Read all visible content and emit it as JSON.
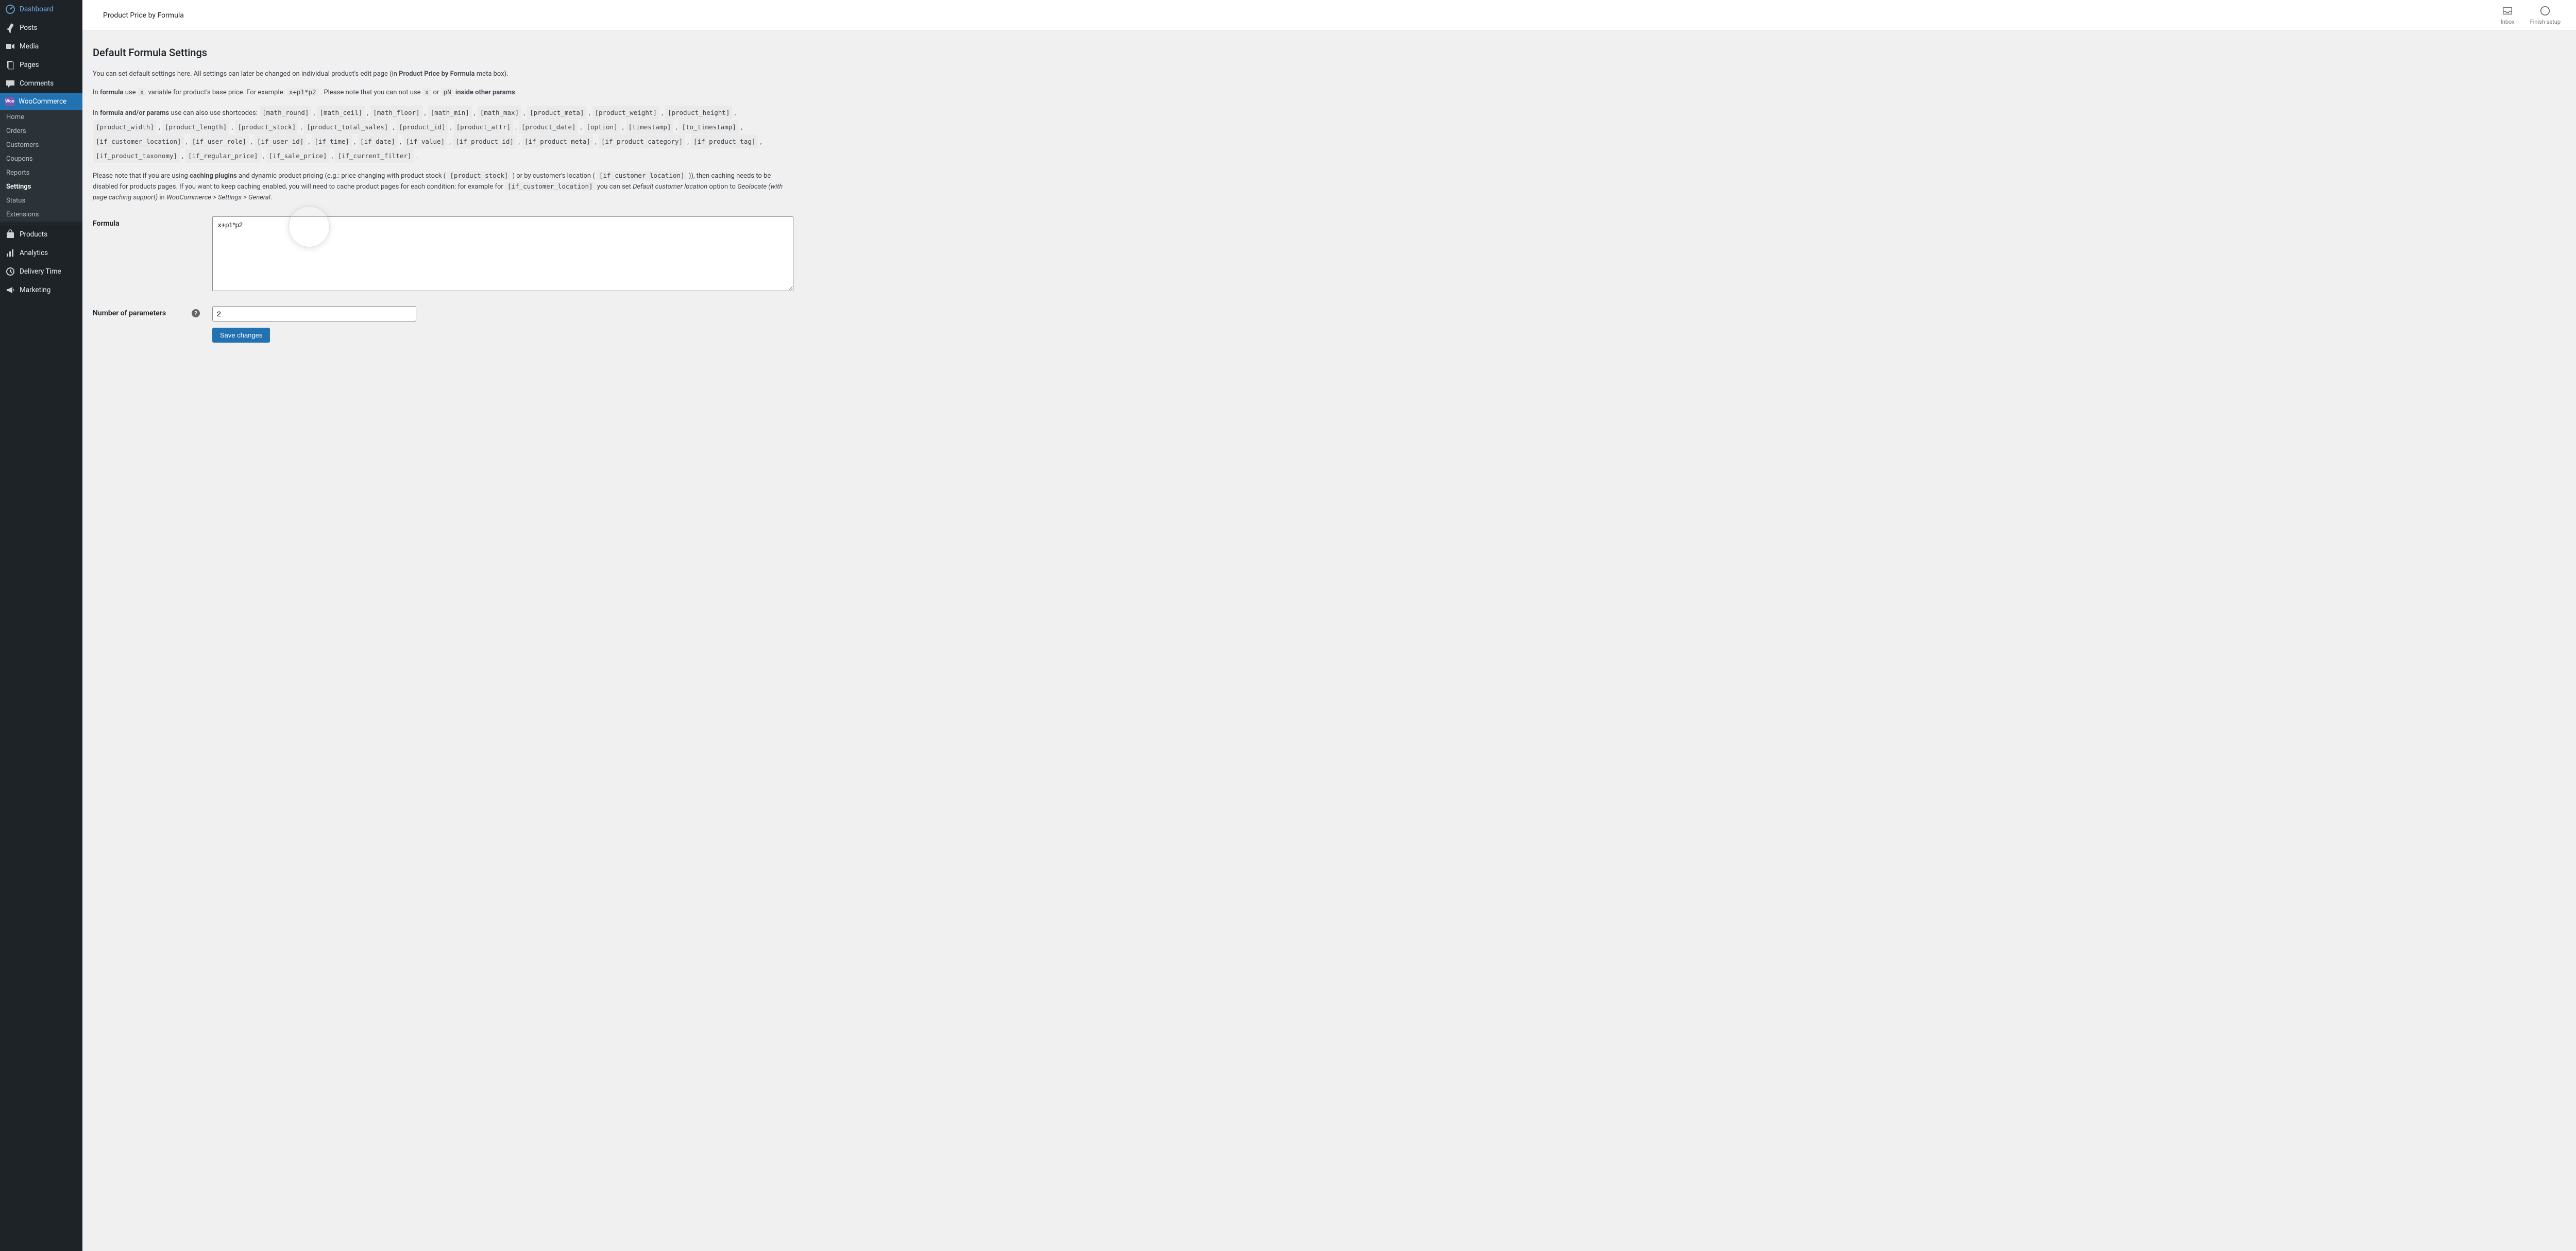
{
  "sidebar": {
    "items": [
      {
        "label": "Dashboard"
      },
      {
        "label": "Posts"
      },
      {
        "label": "Media"
      },
      {
        "label": "Pages"
      },
      {
        "label": "Comments"
      },
      {
        "label": "WooCommerce"
      },
      {
        "label": "Products"
      },
      {
        "label": "Analytics"
      },
      {
        "label": "Delivery Time"
      },
      {
        "label": "Marketing"
      }
    ],
    "sub": [
      "Home",
      "Orders",
      "Customers",
      "Coupons",
      "Reports",
      "Settings",
      "Status",
      "Extensions"
    ]
  },
  "topbar": {
    "title": "Product Price by Formula",
    "inbox": "Inbox",
    "finish": "Finish setup"
  },
  "page": {
    "heading": "Default Formula Settings",
    "p1_a": "You can set default settings here. All settings can later be changed on individual product's edit page (in ",
    "p1_b": "Product Price by Formula",
    "p1_c": " meta box).",
    "p2_a": "In ",
    "p2_b": "formula",
    "p2_c": " use ",
    "p2_code1": "x",
    "p2_d": " variable for product's base price. For example: ",
    "p2_code2": "x+p1*p2",
    "p2_e": " . Please note that you can not use ",
    "p2_code3": "x",
    "p2_f": " or ",
    "p2_code4": "pN",
    "p2_g": " inside other params",
    "p3_a": "In ",
    "p3_b": "formula and/or params",
    "p3_c": " use can also use shortcodes: ",
    "shortcodes": [
      "[math_round]",
      "[math_ceil]",
      "[math_floor]",
      "[math_min]",
      "[math_max]",
      "[product_meta]",
      "[product_weight]",
      "[product_height]",
      "[product_width]",
      "[product_length]",
      "[product_stock]",
      "[product_total_sales]",
      "[product_id]",
      "[product_attr]",
      "[product_date]",
      "[option]",
      "[timestamp]",
      "[to_timestamp]",
      "[if_customer_location]",
      "[if_user_role]",
      "[if_user_id]",
      "[if_time]",
      "[if_date]",
      "[if_value]",
      "[if_product_id]",
      "[if_product_meta]",
      "[if_product_category]",
      "[if_product_tag]",
      "[if_product_taxonomy]",
      "[if_regular_price]",
      "[if_sale_price]",
      "[if_current_filter]"
    ],
    "p4_a": "Please note that if you are using ",
    "p4_b": "caching plugins",
    "p4_c": " and dynamic product pricing (e.g.: price changing with product stock ( ",
    "p4_code1": "[product_stock]",
    "p4_d": " ) or by customer's location ( ",
    "p4_code2": "[if_customer_location]",
    "p4_e": " )), then caching needs to be disabled for products pages. If you want to keep caching enabled, you will need to cache product pages for each condition: for example for ",
    "p4_code3": "[if_customer_location]",
    "p4_f": " you can set ",
    "p4_i1": "Default customer location",
    "p4_g": " option to ",
    "p4_i2": "Geolocate (with page caching support)",
    "p4_h": " in ",
    "p4_i3": "WooCommerce > Settings > General",
    "p4_z": ".",
    "formula_label": "Formula",
    "formula_value": "x+p1*p2",
    "num_label": "Number of parameters",
    "num_value": "2",
    "save": "Save changes"
  }
}
